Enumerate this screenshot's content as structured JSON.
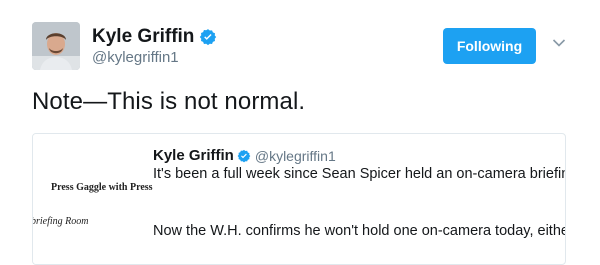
{
  "author": {
    "name": "Kyle Griffin",
    "handle": "@kylegriffin1"
  },
  "follow_button": {
    "label": "Following"
  },
  "tweet": {
    "text": "Note—This is not normal."
  },
  "quoted": {
    "name": "Kyle Griffin",
    "handle": "@kylegriffin1",
    "line1": "It's been a full week since Sean Spicer held an on-camera briefing.",
    "line2": "Now the W.H. confirms he won't hold one on-camera today, either.",
    "thumbnail": {
      "line1": "Press Gaggle with Press",
      "line2": "briefing Room"
    }
  },
  "colors": {
    "accent": "#1da1f2",
    "muted": "#657786",
    "border": "#e1e8ed"
  },
  "icons": [
    "verified-badge-icon",
    "chevron-down-icon"
  ]
}
